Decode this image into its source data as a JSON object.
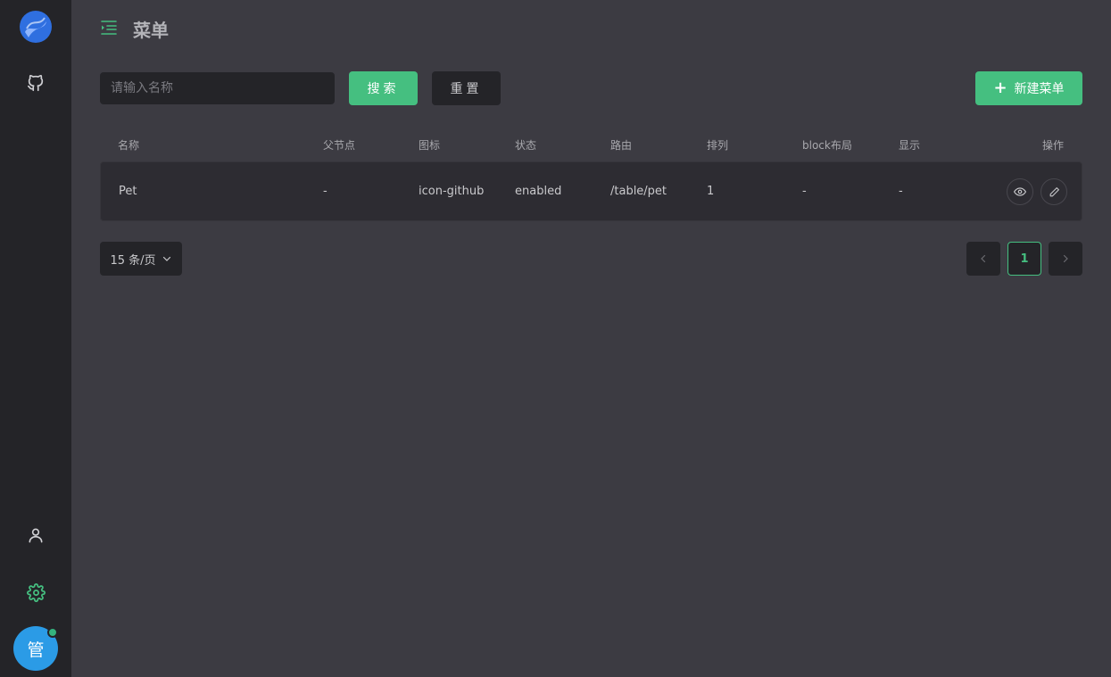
{
  "colors": {
    "accent": "#45bf80",
    "sidebar_bg": "#242428",
    "main_bg": "#3c3b42",
    "avatar_bg": "#2b9be6"
  },
  "sidebar": {
    "items": [
      {
        "icon": "github-icon"
      },
      {
        "icon": "user-icon"
      },
      {
        "icon": "gear-icon"
      }
    ],
    "avatar_text": "管"
  },
  "header": {
    "title": "菜单"
  },
  "toolbar": {
    "search_placeholder": "请输入名称",
    "search_label": "搜索",
    "reset_label": "重置",
    "new_label": "新建菜单"
  },
  "table": {
    "columns": [
      "名称",
      "父节点",
      "图标",
      "状态",
      "路由",
      "排列",
      "block布局",
      "显示",
      "操作"
    ],
    "rows": [
      {
        "name": "Pet",
        "parent": "-",
        "icon": "icon-github",
        "status": "enabled",
        "route": "/table/pet",
        "order": "1",
        "block": "-",
        "display": "-"
      }
    ]
  },
  "pagination": {
    "page_size": "15 条/页",
    "current_page": "1"
  }
}
